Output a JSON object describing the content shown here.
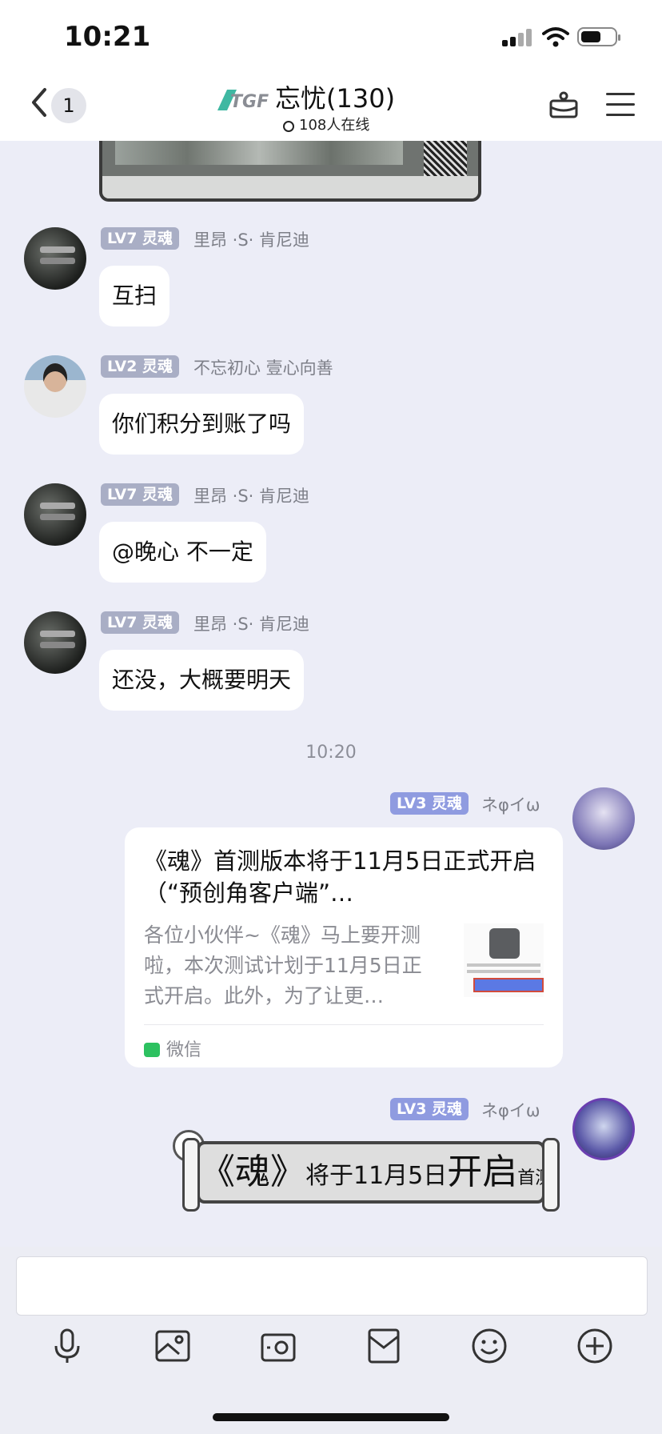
{
  "status": {
    "time": "10:21"
  },
  "header": {
    "unread": "1",
    "title": "忘忧(130)",
    "online": "108人在线",
    "logo_text": "TGF"
  },
  "messages": [
    {
      "level": "LV7 灵魂",
      "nick": "里昂 ·S· 肯尼迪",
      "text": "互扫"
    },
    {
      "level": "LV2 灵魂",
      "nick": "不忘初心 壹心向善",
      "text": "你们积分到账了吗"
    },
    {
      "level": "LV7 灵魂",
      "nick": "里昂 ·S· 肯尼迪",
      "text": "@晚心 不一定"
    },
    {
      "level": "LV7 灵魂",
      "nick": "里昂 ·S· 肯尼迪",
      "text": "还没，大概要明天"
    }
  ],
  "time_separator": "10:20",
  "outgoing": [
    {
      "level": "LV3 灵魂",
      "nick": "ネφイω"
    },
    {
      "level": "LV3 灵魂",
      "nick": "ネφイω"
    }
  ],
  "link_card": {
    "title": "《魂》首测版本将于11月5日正式开启（“预创角客户端”…",
    "description": "各位小伙伴~《魂》马上要开测啦，本次测试计划于11月5日正式开启。此外，为了让更…",
    "source": "微信"
  },
  "sticker": {
    "part1": "《魂》",
    "part2": "将于11月5日",
    "part3": "开启",
    "part4": "首测"
  },
  "toolbar": {
    "icons": [
      "microphone-icon",
      "photo-icon",
      "camera-icon",
      "mail-icon",
      "emoji-icon",
      "plus-icon"
    ]
  }
}
